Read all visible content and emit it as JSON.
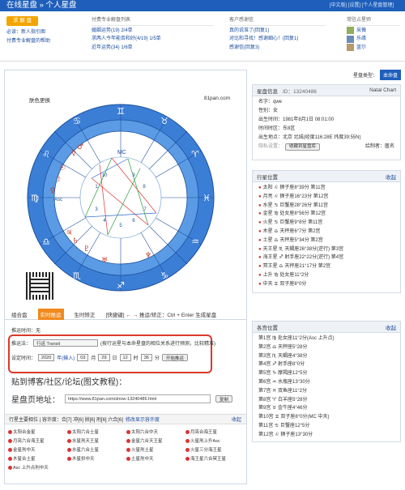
{
  "topbar": {
    "title": "在线星盘 » 个人星盘",
    "right_text": "[中文版]  [设置]  [个人星盘管理]"
  },
  "info": {
    "request_btn": "求 解 盘",
    "links1": [
      "必读：新人指引图",
      "付费专业解盘的帮助"
    ],
    "paid_header": "付费专业解盘列表",
    "paid_items": [
      "婚姻运势(19) 2/4单",
      "求两人今年能否和好(4/19) 1/5单",
      "近年运势(34) 1/6单"
    ],
    "customer_header": "客户感谢信",
    "customer_items": [
      "真的说准了(回复1)",
      "对比和寻找！感谢细心！(回复1)",
      "感谢信(回复3)"
    ],
    "reader_header": "常驻占星师",
    "readers": [
      "采薇",
      "乐缘",
      "蓝尔"
    ]
  },
  "chart": {
    "label_left": "肤色更换",
    "label_right": "81pan.com",
    "mc": "MC",
    "asc": "Asc"
  },
  "tabs": [
    {
      "label": "组合盘",
      "active": false
    },
    {
      "label": "实时推运",
      "active": true
    },
    {
      "label": "生时矫正",
      "active": false
    }
  ],
  "shortcut": "[快捷键] ← → 推运/矫正：Ctrl + Enter 生成星盘",
  "push_time_label": "推运时间：无",
  "push_form": {
    "method_label": "推运法：",
    "method_value": "行运 Transit",
    "method_note": "(按行运星与本命星盘的相位关系进行预测，比较精准)",
    "time_label": "设定时间：",
    "year": "2020",
    "year_unit": "年(输入)",
    "month": "03",
    "month_unit": "月",
    "day": "29",
    "day_unit": "日",
    "hour": "12",
    "hour_unit": "时",
    "minute": "36",
    "minute_unit": "分",
    "start_btn": "开始推运"
  },
  "paste": {
    "title": "贴到博客/社区/论坛(图文教程)：",
    "url_label": "星盘页地址：",
    "url": "https://www.81pan.com/show-13240486.html",
    "copy_btn": "复制"
  },
  "phase": {
    "title": "行星主要相位 | 容许度：合[7] 冲[6] 拱[6] 刑[6] 六合[6]",
    "edit": "修改显示容许度",
    "collapse": "收起"
  },
  "aspects": [
    "太阳合金星",
    "太阳六合土星",
    "太阳六合中天",
    "月亮合海王星",
    "月亮六合海王星",
    "水星刑天王星",
    "金星六合天王星",
    "火星刑上升Asc",
    "金星刑中天",
    "水星六合土星",
    "火星刑土星",
    "火星三分海王星",
    "木星合土星",
    "木星拱中天",
    "土星刑中天",
    "海王星六合冥王星",
    "Asc 上升点刑中天"
  ],
  "right": {
    "type_label": "星盘类型：",
    "type_value": "本命盘",
    "info_header": "星盘信息",
    "id_text": "ID：13240486",
    "natal": "Natal Chart",
    "name": "名字：qwe",
    "sex": "性别：女",
    "birth": "出生时间：1981年8月1日 08:01:00",
    "tz": "时间时区：东8区",
    "place": "出生地点：北京 北城(经度116:28E 纬度39:55N)",
    "hide_label": "隐私设置：",
    "save_btn": "收藏到星盘库",
    "drawer": "绘制者：匿名",
    "planets_header": "行星位置",
    "planets_collapse": "收起",
    "planets": [
      "太阳 ♌ 狮子座8°39分 第11宫",
      "月亮 ♌ 狮子座16°23分 第12宫",
      "水星 ♋ 巨蟹座28°26分 第11宫",
      "金星 ♍ 处女座8°56分 第12宫",
      "火星 ♋ 巨蟹座9°8分 第11宫",
      "木星 ♎ 天秤座6°7分 第2宫",
      "土星 ♎ 天秤座5°34分 第2宫",
      "天王星 ♏ 天蝎座26°38分(逆行) 第3宫",
      "海王星 ♐ 射手座22°22分(逆行) 第4宫",
      "冥王星 ♎ 天秤座21°17分 第2宫",
      "上升 ♍ 处女座11°2分",
      "中天 ♊ 双子座8°0分"
    ],
    "houses_header": "各宫位置",
    "houses_collapse": "收起",
    "houses": [
      "第1宫 ♍ 处女座11°2分(Asc 上升点)",
      "第2宫 ♎ 天秤座5°28分",
      "第3宫 ♏ 天蝎座4°38分",
      "第4宫 ♐ 射手座8°0分",
      "第5宫 ♑ 摩羯座12°5分",
      "第6宫 ♒ 水瓶座13°30分",
      "第7宫 ♓ 双鱼座11°2分",
      "第8宫 ♈ 白羊座5°28分",
      "第9宫 ♉ 金牛座4°46分",
      "第10宫 ♊ 双子座8°0分(MC 中天)",
      "第11宫 ♋ 巨蟹座12°5分",
      "第12宫 ♌ 狮子座13°30分"
    ]
  }
}
